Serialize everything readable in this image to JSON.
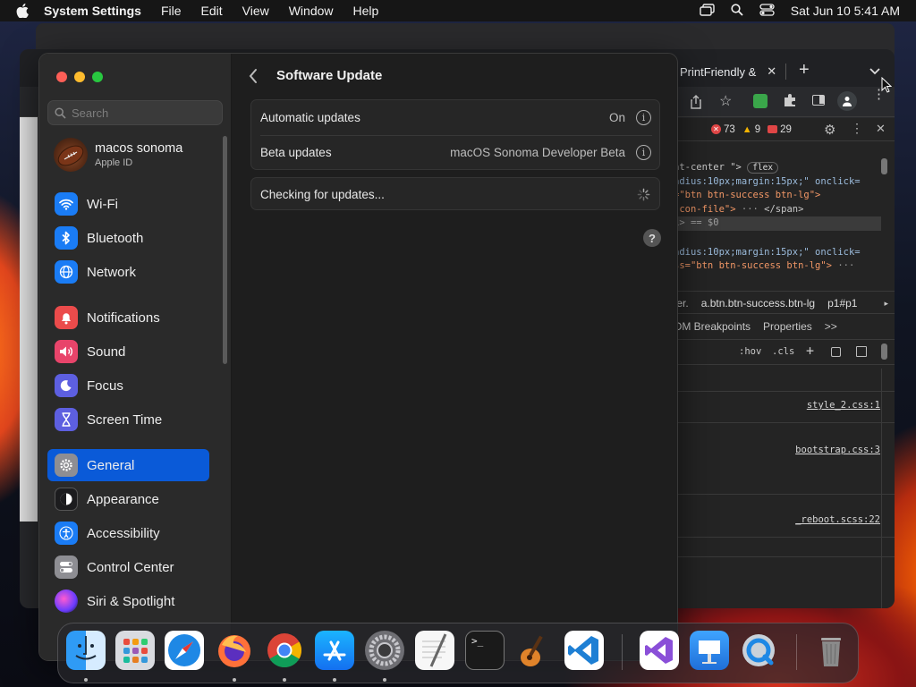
{
  "menubar": {
    "app_name": "System Settings",
    "menus": [
      "File",
      "Edit",
      "View",
      "Window",
      "Help"
    ],
    "datetime": "Sat Jun 10  5:41 AM"
  },
  "browser": {
    "tab_title": "PrintFriendly &",
    "devtools": {
      "counts": {
        "errors": "73",
        "warnings": "9",
        "issues": "29"
      },
      "code_lines": [
        "nt-center \">",
        "adius:10px;margin:15px;\" onclick=",
        "=\"btn btn-success btn-lg\">",
        ".con-file\">",
        "</span>",
        "1> == $0",
        "adius:10px;margin:15px;\" onclick=",
        "ss=\"btn btn-success btn-lg\">"
      ],
      "flex_badge": "flex",
      "breadcrumbs": [
        "ter.",
        "a.btn.btn-success.btn-lg",
        "p1#p1"
      ],
      "panel_tabs": [
        "OM Breakpoints",
        "Properties",
        ">>"
      ],
      "hov_label": ":hov",
      "cls_label": ".cls",
      "links": [
        "style_2.css:1",
        "bootstrap.css:3",
        "_reboot.scss:22"
      ]
    }
  },
  "settings": {
    "search_placeholder": "Search",
    "profile": {
      "name": "macos sonoma",
      "sub": "Apple ID"
    },
    "sidebar_items": [
      {
        "label": "Wi-Fi"
      },
      {
        "label": "Bluetooth"
      },
      {
        "label": "Network"
      },
      {
        "label": "Notifications"
      },
      {
        "label": "Sound"
      },
      {
        "label": "Focus"
      },
      {
        "label": "Screen Time"
      },
      {
        "label": "General"
      },
      {
        "label": "Appearance"
      },
      {
        "label": "Accessibility"
      },
      {
        "label": "Control Center"
      },
      {
        "label": "Siri & Spotlight"
      }
    ],
    "page_title": "Software Update",
    "rows": {
      "automatic_updates": {
        "label": "Automatic updates",
        "value": "On"
      },
      "beta_updates": {
        "label": "Beta updates",
        "value": "macOS Sonoma Developer Beta"
      }
    },
    "status": "Checking for updates...",
    "help": "?"
  },
  "dock": {
    "apps": [
      "finder-icon",
      "launchpad-icon",
      "safari-icon",
      "firefox-icon",
      "chrome-icon",
      "app-store-icon",
      "system-settings-icon",
      "textedit-icon",
      "terminal-icon",
      "garageband-icon",
      "vscode-icon",
      "visual-studio-icon",
      "keynote-icon",
      "quicktime-icon",
      "trash-icon"
    ]
  },
  "colors": {
    "accent": "#0a5ad8",
    "menubar": "#161616"
  }
}
